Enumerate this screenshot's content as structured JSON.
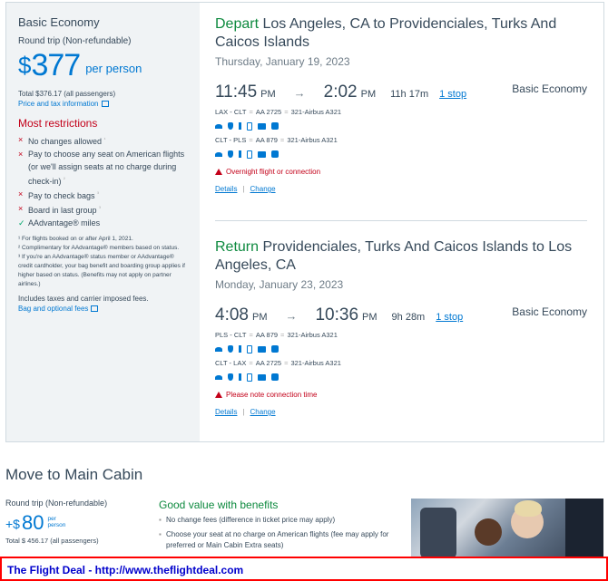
{
  "fare": {
    "name": "Basic Economy",
    "trip_type": "Round trip (Non-refundable)",
    "currency_symbol": "$",
    "price": "377",
    "per_person": "per person",
    "total": "Total $376.17 (all passengers)",
    "tax_link": "Price and tax information",
    "restrictions_title": "Most restrictions",
    "restrictions": [
      {
        "mark": "×",
        "text": "No changes allowed",
        "sup": "¹"
      },
      {
        "mark": "×",
        "text": "Pay to choose any seat on American flights (or we'll assign seats at no charge during check-in)",
        "sup": "²"
      },
      {
        "mark": "×",
        "text": "Pay to check bags",
        "sup": "³"
      },
      {
        "mark": "×",
        "text": "Board in last group",
        "sup": "³"
      },
      {
        "mark": "✓",
        "text": "AAdvantage® miles",
        "sup": ""
      }
    ],
    "notes": [
      "¹ For flights booked on or after April 1, 2021.",
      "² Complimentary for AAdvantage® members based on status.",
      "³ If you're an AAdvantage® status member or AAdvantage® credit cardholder, your bag benefit and boarding group applies if higher based on status. (Benefits may not apply on partner airlines.)"
    ],
    "includes": "Includes taxes and carrier imposed fees.",
    "bag_link": "Bag and optional fees"
  },
  "depart": {
    "lead": "Depart",
    "route": " Los Angeles, CA to Providenciales, Turks And Caicos Islands",
    "date": "Thursday, January 19, 2023",
    "dep_time": "11:45",
    "dep_ampm": "PM",
    "arrow": "→",
    "arr_time": "2:02",
    "arr_ampm": "PM",
    "duration": "11h 17m",
    "stops": "1 stop",
    "cabin": "Basic Economy",
    "legs": [
      {
        "route": "LAX - CLT",
        "flight": "AA 2725",
        "aircraft": "321-Airbus A321"
      },
      {
        "route": "CLT - PLS",
        "flight": "AA 879",
        "aircraft": "321-Airbus A321"
      }
    ],
    "warning": "Overnight flight or connection",
    "details": "Details",
    "change": "Change"
  },
  "return": {
    "lead": "Return",
    "route": " Providenciales, Turks And Caicos Islands to Los Angeles, CA",
    "date": "Monday, January 23, 2023",
    "dep_time": "4:08",
    "dep_ampm": "PM",
    "arrow": "→",
    "arr_time": "10:36",
    "arr_ampm": "PM",
    "duration": "9h 28m",
    "stops": "1 stop",
    "cabin": "Basic Economy",
    "legs": [
      {
        "route": "PLS - CLT",
        "flight": "AA 879",
        "aircraft": "321-Airbus A321"
      },
      {
        "route": "CLT - LAX",
        "flight": "AA 2725",
        "aircraft": "321-Airbus A321"
      }
    ],
    "warning": "Please note connection time",
    "details": "Details",
    "change": "Change"
  },
  "upsell": {
    "title": "Move to Main Cabin",
    "trip_type": "Round trip (Non-refundable)",
    "plus": "+$",
    "price": "80",
    "per": "per",
    "person": "person",
    "total": "Total $ 456.17 (all passengers)",
    "value_title": "Good value with benefits",
    "bullets": [
      "No change fees (difference in ticket price may apply)",
      "Choose your seat at no charge on American flights (fee may apply for preferred or Main Cabin Extra seats)"
    ]
  },
  "banner": {
    "text": "The Flight Deal - http://www.theflightdeal.com"
  },
  "colors": {
    "brand_blue": "#0078d2",
    "lead_green": "#0e8a3f",
    "alert_red": "#c30019",
    "banner_border": "#ff0000",
    "banner_text": "#0000cc"
  }
}
